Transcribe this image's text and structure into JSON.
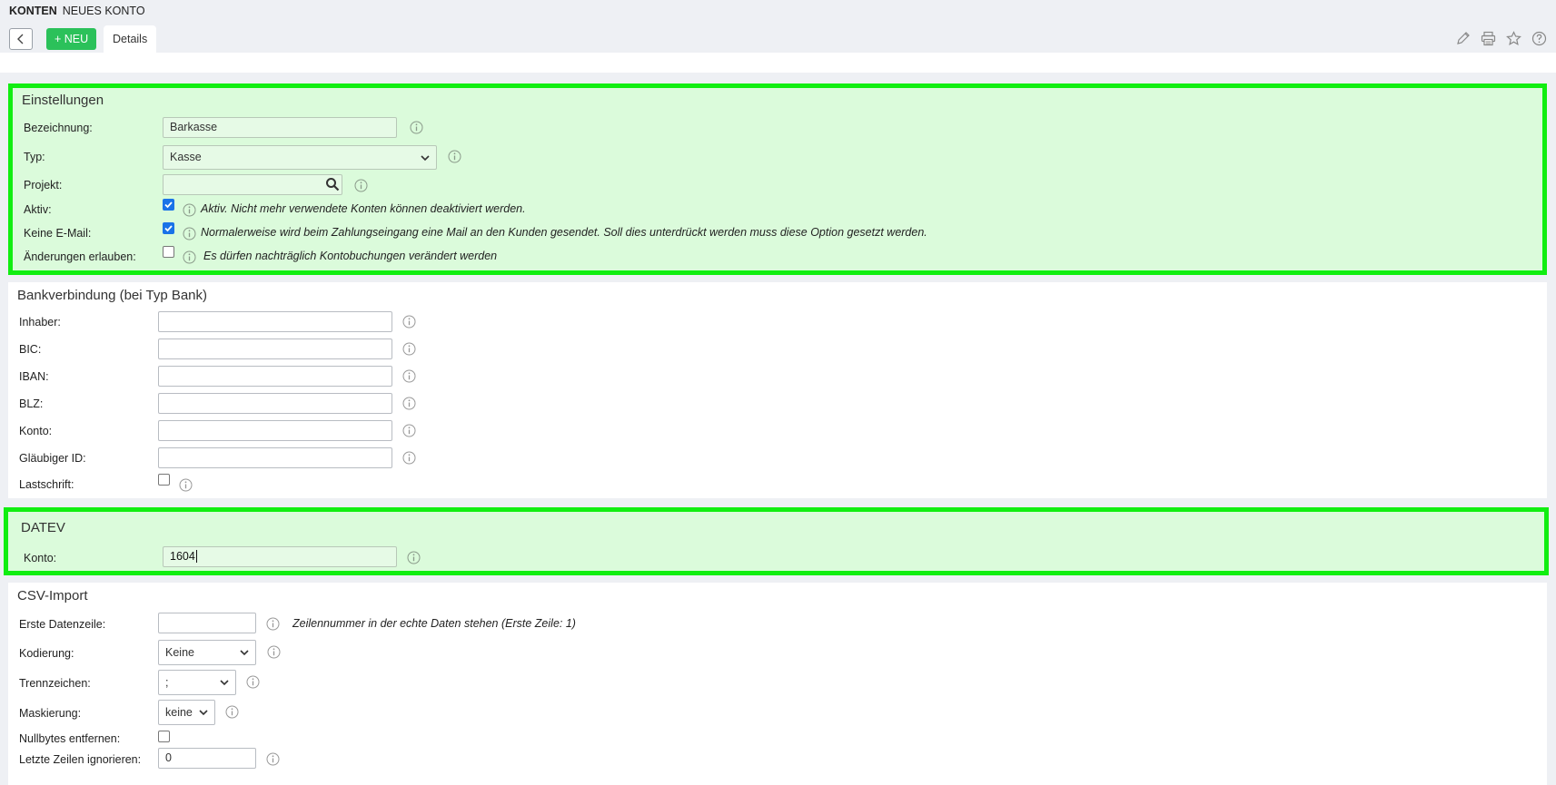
{
  "breadcrumb": {
    "section": "KONTEN",
    "page": "NEUES KONTO"
  },
  "toolbar": {
    "new_label": "+ NEU",
    "tab_details": "Details"
  },
  "settings": {
    "title": "Einstellungen",
    "bezeichnung_label": "Bezeichnung:",
    "bezeichnung_value": "Barkasse",
    "typ_label": "Typ:",
    "typ_value": "Kasse",
    "projekt_label": "Projekt:",
    "projekt_value": "",
    "aktiv_label": "Aktiv:",
    "aktiv_checked": true,
    "aktiv_note": "Aktiv. Nicht mehr verwendete Konten können deaktiviert werden.",
    "keine_email_label": "Keine E-Mail:",
    "keine_email_checked": true,
    "keine_email_note": "Normalerweise wird beim Zahlungseingang eine Mail an den Kunden gesendet. Soll dies unterdrückt werden muss diese Option gesetzt werden.",
    "aenderungen_label": "Änderungen erlauben:",
    "aenderungen_checked": false,
    "aenderungen_note": "Es dürfen nachträglich Kontobuchungen verändert werden"
  },
  "bank": {
    "title": "Bankverbindung (bei Typ Bank)",
    "inhaber_label": "Inhaber:",
    "bic_label": "BIC:",
    "iban_label": "IBAN:",
    "blz_label": "BLZ:",
    "konto_label": "Konto:",
    "glaeubiger_label": "Gläubiger ID:",
    "lastschrift_label": "Lastschrift:",
    "lastschrift_checked": false
  },
  "datev": {
    "title": "DATEV",
    "konto_label": "Konto:",
    "konto_value": "1604"
  },
  "csv": {
    "title": "CSV-Import",
    "erste_label": "Erste Datenzeile:",
    "erste_value": "",
    "erste_note": "Zeilennummer in der echte Daten stehen (Erste Zeile: 1)",
    "kodierung_label": "Kodierung:",
    "kodierung_value": "Keine",
    "trennzeichen_label": "Trennzeichen:",
    "trennzeichen_value": ";",
    "maskierung_label": "Maskierung:",
    "maskierung_value": "keine",
    "nullbytes_label": "Nullbytes entfernen:",
    "nullbytes_checked": false,
    "letzte_label": "Letzte Zeilen ignorieren:",
    "letzte_value": "0"
  },
  "colors": {
    "highlight_border": "#11ee11",
    "highlight_fill": "#dbfbdb",
    "accent_green": "#2bc15a",
    "checkbox_blue": "#1a73e8"
  },
  "icons": [
    "back-icon",
    "pencil-icon",
    "print-icon",
    "star-icon",
    "help-icon",
    "info-icon",
    "search-icon",
    "chevron-down-icon",
    "check-icon"
  ]
}
